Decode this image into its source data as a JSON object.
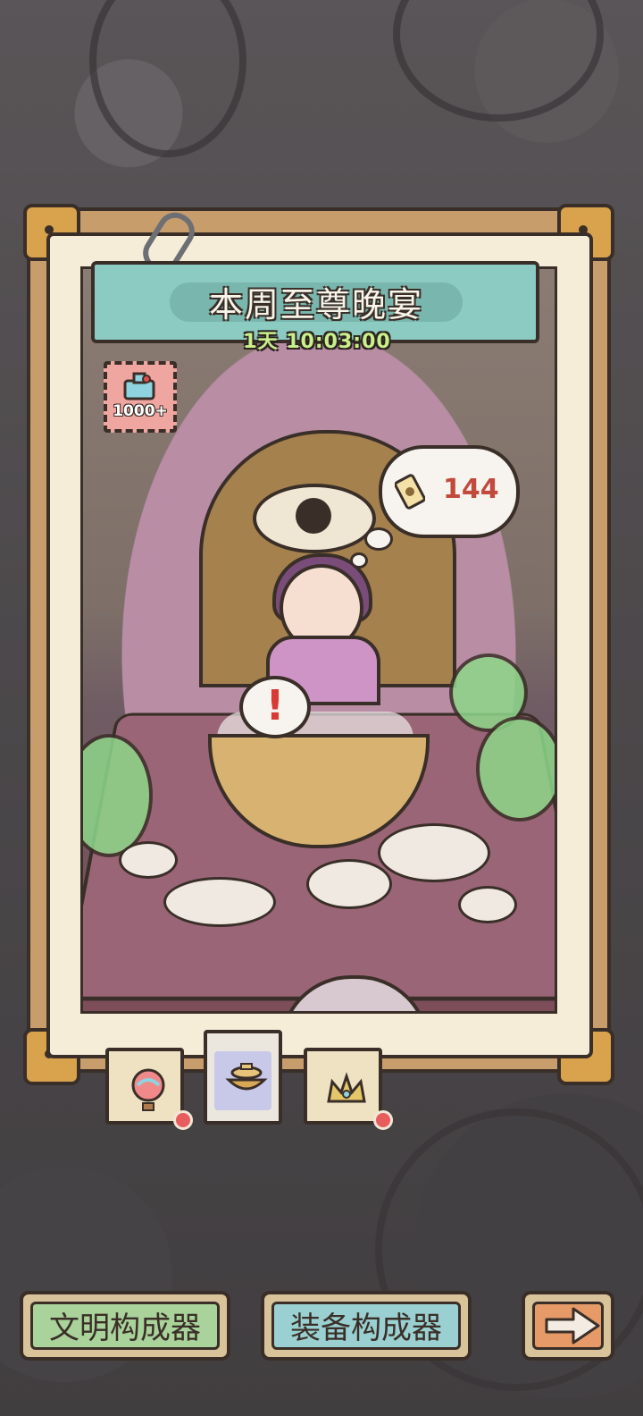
{
  "event": {
    "title": "本周至尊晚宴",
    "timer": "1天 10:03:00",
    "stamp_count": "1000+",
    "bubble_count": "144",
    "alert_mark": "!"
  },
  "tabs": [
    {
      "icon": "balloon-icon",
      "active": false,
      "has_notification": true
    },
    {
      "icon": "hotpot-icon",
      "active": true,
      "has_notification": false
    },
    {
      "icon": "crown-icon",
      "active": false,
      "has_notification": true
    }
  ],
  "buttons": {
    "civilization_composer": "文明构成器",
    "equipment_composer": "装备构成器",
    "next_icon": "arrow-right-icon"
  },
  "colors": {
    "frame_brown": "#c79d6b",
    "banner_teal": "#8ccbc2",
    "timer_green": "#c9f08a",
    "count_red": "#c24a3d",
    "button_green": "#a9d39a",
    "button_teal": "#9ad0d1",
    "button_orange": "#e59a67"
  }
}
